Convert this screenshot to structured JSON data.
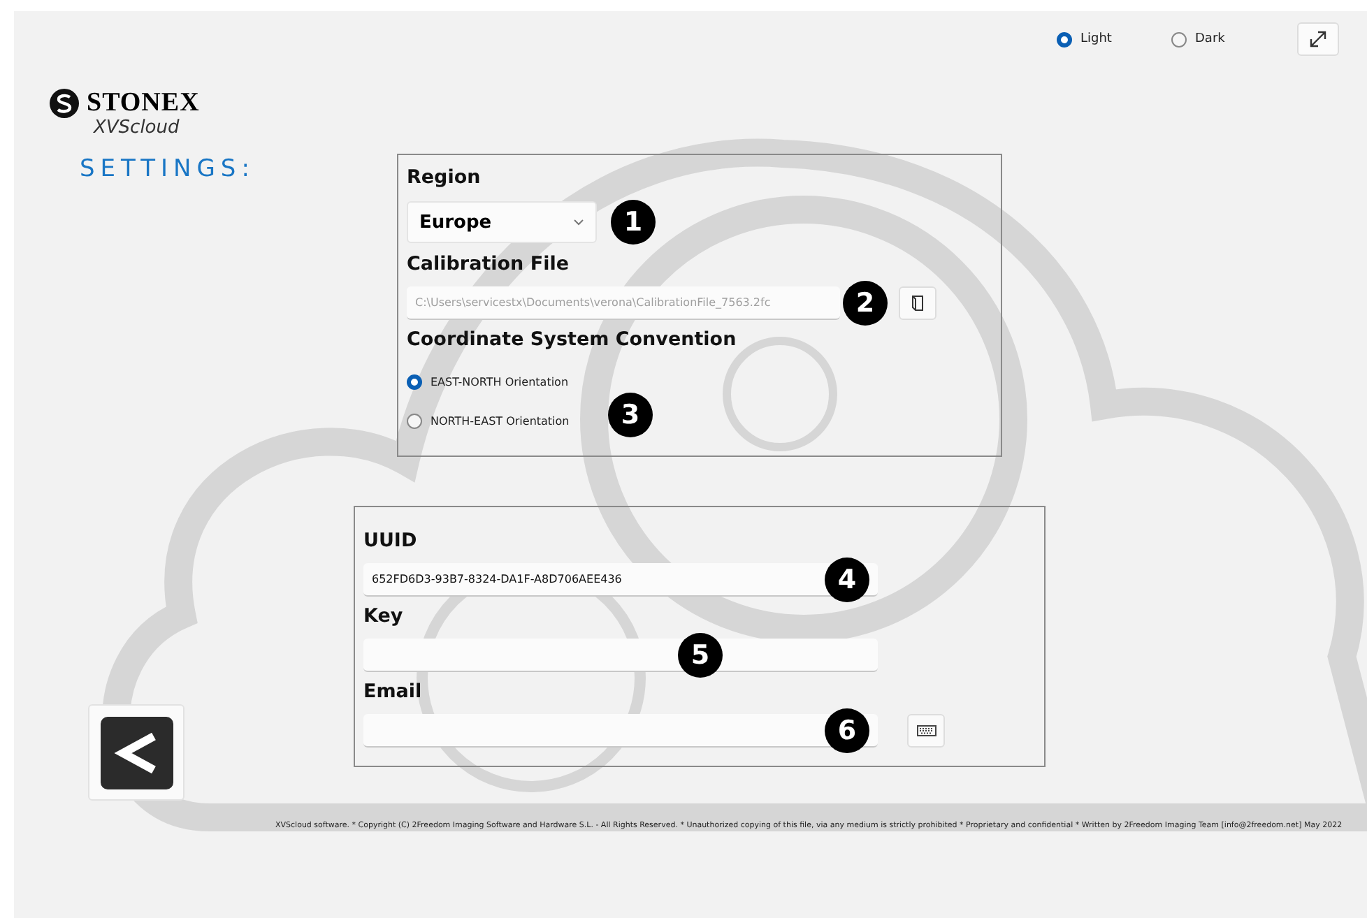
{
  "theme_options": [
    {
      "label": "Light",
      "selected": true
    },
    {
      "label": "Dark",
      "selected": false
    }
  ],
  "logo": {
    "brand": "STONEX",
    "product": "XVScloud"
  },
  "page_title": "SETTINGS:",
  "region": {
    "label": "Region",
    "value": "Europe",
    "callout": "1"
  },
  "calibration_file": {
    "label": "Calibration File",
    "value": "C:\\Users\\servicestx\\Documents\\verona\\CalibrationFile_7563.2fc",
    "disabled": true,
    "callout": "2"
  },
  "coordinate_convention": {
    "label": "Coordinate System Convention",
    "callout": "3",
    "options": [
      {
        "label": "EAST-NORTH Orientation",
        "selected": true
      },
      {
        "label": "NORTH-EAST Orientation",
        "selected": false
      }
    ]
  },
  "license_fields": [
    {
      "label": "UUID",
      "value": "652FD6D3-93B7-8324-DA1F-A8D706AEE436",
      "callout": "4",
      "keyboard_button": false
    },
    {
      "label": "Key",
      "callout": "5",
      "keyboard_button": false
    },
    {
      "label": "Email",
      "callout": "6",
      "keyboard_button": true
    }
  ],
  "footer": "XVScloud software. * Copyright (C) 2Freedom Imaging Software and Hardware S.L. - All Rights Reserved. * Unauthorized copying of this file, via any medium is strictly prohibited * Proprietary and confidential * Written by 2Freedom Imaging Team [info@2freedom.net] May 2022"
}
